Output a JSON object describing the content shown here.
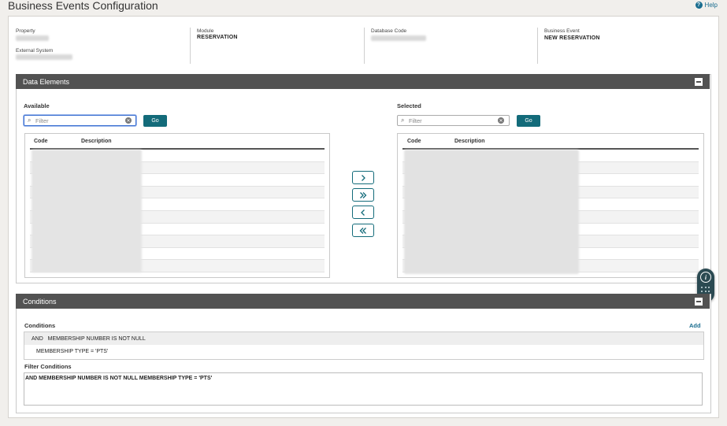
{
  "page": {
    "title": "Business Events Configuration",
    "help_label": "Help"
  },
  "info": {
    "property_label": "Property",
    "external_system_label": "External System",
    "module_label": "Module",
    "module_value": "RESERVATION",
    "database_code_label": "Database Code",
    "business_event_label": "Business Event",
    "business_event_value": "NEW RESERVATION"
  },
  "data_elements": {
    "title": "Data Elements",
    "available_label": "Available",
    "selected_label": "Selected",
    "filter_placeholder": "Filter",
    "go_label": "Go",
    "columns": [
      "Code",
      "Description"
    ]
  },
  "conditions": {
    "title": "Conditions",
    "sub_title": "Conditions",
    "add_label": "Add",
    "rows": [
      "AND   MEMBERSHIP NUMBER IS NOT NULL",
      "MEMBERSHIP TYPE = 'PTS'"
    ],
    "filter_conditions_label": "Filter Conditions",
    "filter_conditions_text": "AND MEMBERSHIP NUMBER IS NOT NULL MEMBERSHIP TYPE = 'PTS'"
  },
  "icons": {
    "help": "help-circle-icon",
    "search": "search-icon",
    "clear": "clear-icon",
    "move_right": "chevron-right-icon",
    "move_all_right": "double-chevron-right-icon",
    "move_left": "chevron-left-icon",
    "move_all_left": "double-chevron-left-icon",
    "collapse": "collapse-icon",
    "info": "info-icon",
    "grid": "dots-grid-icon"
  },
  "colors": {
    "accent": "#136b7a",
    "header_bar": "#525252",
    "link": "#1a6d8f"
  }
}
